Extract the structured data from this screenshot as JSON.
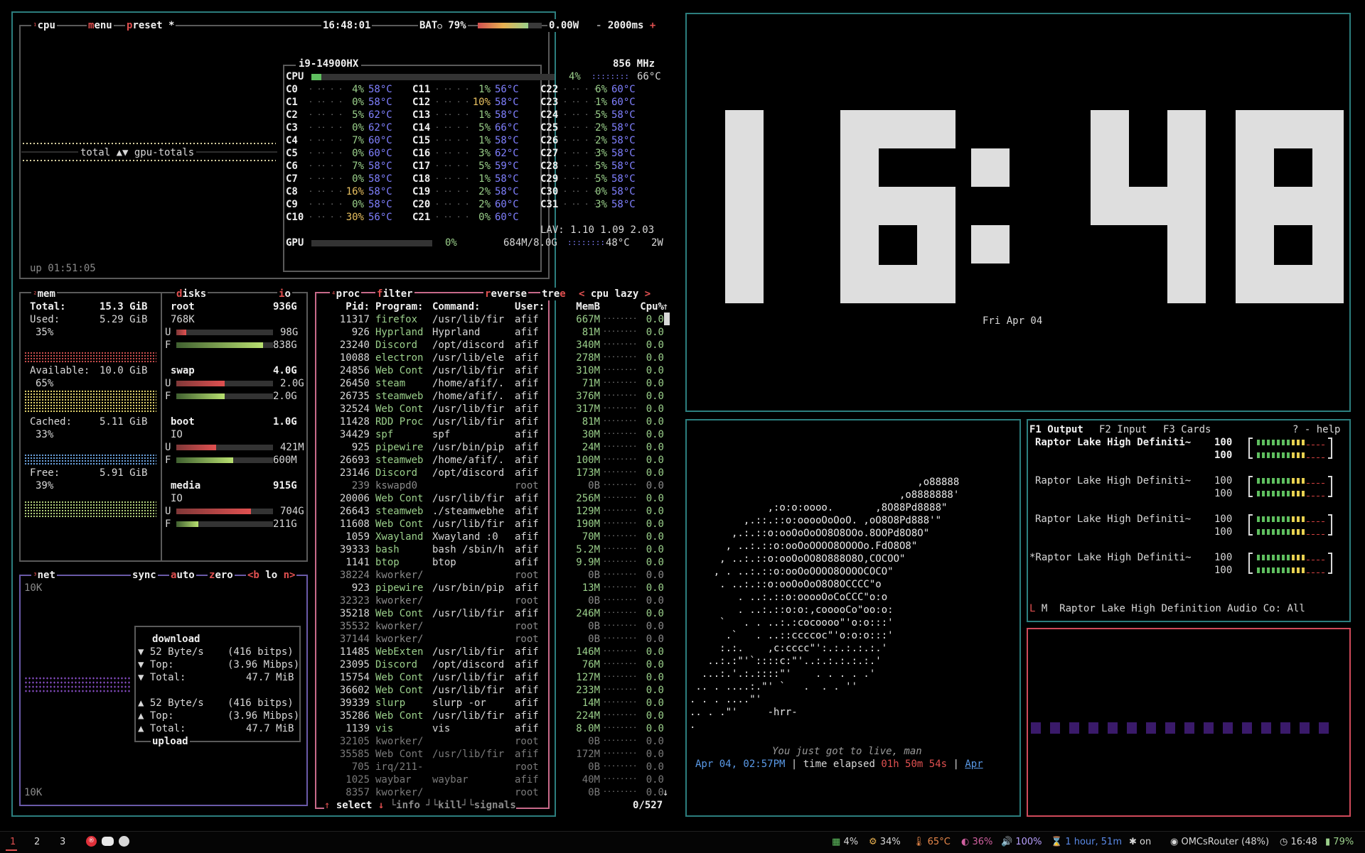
{
  "cpu": {
    "tab": "cpu",
    "menu": "menu",
    "preset": "preset *",
    "clock": "16:48:01",
    "bat_label": "BAT",
    "bat_pct": "79%",
    "bat_level": 0.79,
    "power": "0.00W",
    "interval": "2000ms",
    "model": "i9-14900HX",
    "freq": "856 MHz",
    "total_label": "CPU",
    "total_pct": "4%",
    "total_temp": "66°C",
    "total_level": 0.04,
    "graph_label": "total ▲▼ gpu-totals",
    "uptime": "up 01:51:05",
    "lav_label": "LAV:",
    "lav": "1.10 1.09 2.03",
    "gpu_label": "GPU",
    "gpu_pct": "0%",
    "gpu_mem": "684M/8.0G",
    "gpu_temp": "48°C",
    "gpu_power": "2W",
    "cores": [
      {
        "n": "C0",
        "p": "4%",
        "t": "58°C"
      },
      {
        "n": "C1",
        "p": "0%",
        "t": "58°C"
      },
      {
        "n": "C2",
        "p": "5%",
        "t": "62°C"
      },
      {
        "n": "C3",
        "p": "0%",
        "t": "62°C"
      },
      {
        "n": "C4",
        "p": "7%",
        "t": "60°C"
      },
      {
        "n": "C5",
        "p": "0%",
        "t": "60°C"
      },
      {
        "n": "C6",
        "p": "7%",
        "t": "58°C"
      },
      {
        "n": "C7",
        "p": "0%",
        "t": "58°C"
      },
      {
        "n": "C8",
        "p": "16%",
        "t": "58°C"
      },
      {
        "n": "C9",
        "p": "0%",
        "t": "58°C"
      },
      {
        "n": "C10",
        "p": "30%",
        "t": "56°C"
      },
      {
        "n": "C11",
        "p": "1%",
        "t": "56°C"
      },
      {
        "n": "C12",
        "p": "10%",
        "t": "58°C"
      },
      {
        "n": "C13",
        "p": "1%",
        "t": "58°C"
      },
      {
        "n": "C14",
        "p": "5%",
        "t": "66°C"
      },
      {
        "n": "C15",
        "p": "1%",
        "t": "58°C"
      },
      {
        "n": "C16",
        "p": "3%",
        "t": "62°C"
      },
      {
        "n": "C17",
        "p": "5%",
        "t": "59°C"
      },
      {
        "n": "C18",
        "p": "1%",
        "t": "58°C"
      },
      {
        "n": "C19",
        "p": "2%",
        "t": "58°C"
      },
      {
        "n": "C20",
        "p": "2%",
        "t": "60°C"
      },
      {
        "n": "C21",
        "p": "0%",
        "t": "60°C"
      },
      {
        "n": "C22",
        "p": "6%",
        "t": "60°C"
      },
      {
        "n": "C23",
        "p": "1%",
        "t": "60°C"
      },
      {
        "n": "C24",
        "p": "5%",
        "t": "58°C"
      },
      {
        "n": "C25",
        "p": "2%",
        "t": "58°C"
      },
      {
        "n": "C26",
        "p": "2%",
        "t": "58°C"
      },
      {
        "n": "C27",
        "p": "3%",
        "t": "58°C"
      },
      {
        "n": "C28",
        "p": "5%",
        "t": "58°C"
      },
      {
        "n": "C29",
        "p": "5%",
        "t": "58°C"
      },
      {
        "n": "C30",
        "p": "0%",
        "t": "58°C"
      },
      {
        "n": "C31",
        "p": "3%",
        "t": "58°C"
      }
    ]
  },
  "mem": {
    "tab": "mem",
    "disks_tab": "disks",
    "io_tab": "io",
    "total_label": "Total:",
    "total": "15.3 GiB",
    "used_label": "Used:",
    "used": "5.29 GiB",
    "used_pct": "35%",
    "avail_label": "Available:",
    "avail": "10.0 GiB",
    "avail_pct": "65%",
    "cached_label": "Cached:",
    "cached": "5.11 GiB",
    "cached_pct": "33%",
    "free_label": "Free:",
    "free": "5.91 GiB",
    "free_pct": "39%"
  },
  "disks": [
    {
      "name": "root",
      "size": "936G",
      "io": "768K",
      "used": "98G",
      "free": "838G",
      "u_level": 0.1,
      "f_level": 0.9
    },
    {
      "name": "swap",
      "size": "4.0G",
      "io": "",
      "used": "2.0G",
      "free": "2.0G",
      "u_level": 0.5,
      "f_level": 0.5
    },
    {
      "name": "boot",
      "size": "1.0G",
      "io": "IO",
      "used": "421M",
      "free": "600M",
      "u_level": 0.41,
      "f_level": 0.59
    },
    {
      "name": "media",
      "size": "915G",
      "io": "IO",
      "used": "704G",
      "free": "211G",
      "u_level": 0.77,
      "f_level": 0.23
    }
  ],
  "disk_u": "U",
  "disk_f": "F",
  "net": {
    "tab": "net",
    "sync": "sync",
    "auto": "auto",
    "zero": "zero",
    "iface": "<b lo n>",
    "scale_top": "10K",
    "scale_bottom": "10K",
    "download_title": "download",
    "upload_title": "upload",
    "dl_rate": "▼ 52 Byte/s",
    "dl_rate_bits": "(416 bitps)",
    "dl_top": "▼ Top:",
    "dl_top_val": "(3.96 Mibps)",
    "dl_total": "▼ Total:",
    "dl_total_val": "47.7 MiB",
    "ul_rate": "▲ 52 Byte/s",
    "ul_rate_bits": "(416 bitps)",
    "ul_top": "▲ Top:",
    "ul_top_val": "(3.96 Mibps)",
    "ul_total": "▲ Total:",
    "ul_total_val": "47.7 MiB"
  },
  "proc": {
    "tab": "proc",
    "filter": "filter",
    "reverse": "reverse",
    "tree": "tree",
    "sort": "cpu lazy",
    "sort_left": "<",
    "sort_right": ">",
    "headers": {
      "pid": "Pid:",
      "prog": "Program:",
      "cmd": "Command:",
      "user": "User:",
      "mem": "MemB",
      "cpu": "Cpu%"
    },
    "footer_select": "select",
    "footer_info": "info",
    "footer_kill": "kill",
    "footer_signals": "signals",
    "count": "0/527",
    "rows": [
      [
        "11317",
        "firefox",
        "/usr/lib/fir",
        "afif",
        "667M",
        "0.0"
      ],
      [
        "926",
        "Hyprland",
        "Hyprland",
        "afif",
        "81M",
        "0.0"
      ],
      [
        "23240",
        "Discord",
        "/opt/discord",
        "afif",
        "340M",
        "0.0"
      ],
      [
        "10088",
        "electron",
        "/usr/lib/ele",
        "afif",
        "278M",
        "0.0"
      ],
      [
        "24856",
        "Web Cont",
        "/usr/lib/fir",
        "afif",
        "310M",
        "0.0"
      ],
      [
        "26450",
        "steam",
        "/home/afif/.",
        "afif",
        "71M",
        "0.0"
      ],
      [
        "26735",
        "steamweb",
        "/home/afif/.",
        "afif",
        "376M",
        "0.0"
      ],
      [
        "32524",
        "Web Cont",
        "/usr/lib/fir",
        "afif",
        "317M",
        "0.0"
      ],
      [
        "11428",
        "RDD Proc",
        "/usr/lib/fir",
        "afif",
        "81M",
        "0.0"
      ],
      [
        "34429",
        "spf",
        "spf",
        "afif",
        "30M",
        "0.0"
      ],
      [
        "925",
        "pipewire",
        "/usr/bin/pip",
        "afif",
        "24M",
        "0.0"
      ],
      [
        "26693",
        "steamweb",
        "/home/afif/.",
        "afif",
        "100M",
        "0.0"
      ],
      [
        "23146",
        "Discord",
        "/opt/discord",
        "afif",
        "173M",
        "0.0"
      ],
      [
        "239",
        "kswapd0",
        "",
        "root",
        "0B",
        "0.0"
      ],
      [
        "20006",
        "Web Cont",
        "/usr/lib/fir",
        "afif",
        "256M",
        "0.0"
      ],
      [
        "26643",
        "steamweb",
        "./steamwebhe",
        "afif",
        "129M",
        "0.0"
      ],
      [
        "11608",
        "Web Cont",
        "/usr/lib/fir",
        "afif",
        "190M",
        "0.0"
      ],
      [
        "1059",
        "Xwayland",
        "Xwayland :0",
        "afif",
        "70M",
        "0.0"
      ],
      [
        "39333",
        "bash",
        "bash /sbin/h",
        "afif",
        "5.2M",
        "0.0"
      ],
      [
        "1141",
        "btop",
        "btop",
        "afif",
        "9.9M",
        "0.0"
      ],
      [
        "38224",
        "kworker/",
        "",
        "root",
        "0B",
        "0.0"
      ],
      [
        "923",
        "pipewire",
        "/usr/bin/pip",
        "afif",
        "13M",
        "0.0"
      ],
      [
        "32323",
        "kworker/",
        "",
        "root",
        "0B",
        "0.0"
      ],
      [
        "35218",
        "Web Cont",
        "/usr/lib/fir",
        "afif",
        "246M",
        "0.0"
      ],
      [
        "35532",
        "kworker/",
        "",
        "root",
        "0B",
        "0.0"
      ],
      [
        "37144",
        "kworker/",
        "",
        "root",
        "0B",
        "0.0"
      ],
      [
        "11485",
        "WebExten",
        "/usr/lib/fir",
        "afif",
        "146M",
        "0.0"
      ],
      [
        "23095",
        "Discord",
        "/opt/discord",
        "afif",
        "76M",
        "0.0"
      ],
      [
        "15754",
        "Web Cont",
        "/usr/lib/fir",
        "afif",
        "127M",
        "0.0"
      ],
      [
        "36602",
        "Web Cont",
        "/usr/lib/fir",
        "afif",
        "233M",
        "0.0"
      ],
      [
        "39339",
        "slurp",
        "slurp -or",
        "afif",
        "14M",
        "0.0"
      ],
      [
        "35286",
        "Web Cont",
        "/usr/lib/fir",
        "afif",
        "224M",
        "0.0"
      ],
      [
        "1139",
        "vis",
        "vis",
        "afif",
        "8.0M",
        "0.0"
      ],
      [
        "32105",
        "kworker/",
        "",
        "root",
        "0B",
        "0.0"
      ],
      [
        "35585",
        "Web Cont",
        "/usr/lib/fir",
        "afif",
        "172M",
        "0.0"
      ],
      [
        "705",
        "irq/211-",
        "",
        "root",
        "0B",
        "0.0"
      ],
      [
        "1025",
        "waybar",
        "waybar",
        "afif",
        "40M",
        "0.0"
      ],
      [
        "8357",
        "kworker/",
        "",
        "root",
        "0B",
        "0.0"
      ]
    ]
  },
  "clock": {
    "time_digits": "16:48",
    "date": "Fri Apr 04"
  },
  "art": {
    "lines": [
      "                                      ,o88888",
      "                                   ,o8888888'",
      "             ,:o:o:oooo.       ,8O88Pd8888\"",
      "         ,.::.::o:ooooOoOoO. ,oO8O8Pd888'\"",
      "       ,.:.::o:ooOoOoOO8O8OOo.8OOPd8O8O\"",
      "      , ..:.::o:ooOoOOOO8OOOOo.FdO8O8\"",
      "     , ..:.::o:ooOoOO8O888O8O,COCOO\"",
      "    , . ..:.::o:ooOoOOOO8OOOOCOCO\"",
      "     . ..:.::o:ooOoOoO8O8OCCCC\"o",
      "        . ..:.::o:ooooOoCoCCC\"o:o",
      "        . ..:.::o:o:,cooooCo\"oo:o:",
      "     `   . . ..:.:cocoooo\"'o:o:::'",
      "      .`   . ..::ccccoc\"'o:o:o:::'",
      "     :.:.    ,c:cccc\"':.:.:.:.:.'",
      "   ..:.:\"'`::::c:\"'..:.:.:.:.:.'",
      "  ...:.'.:.::::\"'    . . . . .'",
      " .. . ....:.\"' `   .  . . ''",
      ". . . ....\"'",
      ".. . .\"'     -hrr-",
      "."
    ],
    "quote": "You just got to live, man",
    "date_line": "Apr 04, 02:57PM",
    "sep": "|",
    "elapsed_label": "time elapsed",
    "elapsed": "01h 50m 54s",
    "trail": "Apr"
  },
  "audio": {
    "tab1": "F1 Output",
    "tab2": "F2 Input",
    "tab3": "F3 Cards",
    "help": "? - help",
    "devices": [
      {
        "name": "Raptor Lake High Definiti~",
        "l": "100",
        "r": "100",
        "level": 1.0
      },
      {
        "name": "Raptor Lake High Definiti~",
        "l": "100",
        "r": "100",
        "level": 1.0
      },
      {
        "name": "Raptor Lake High Definiti~",
        "l": "100",
        "r": "100",
        "level": 1.0
      },
      {
        "name": "*Raptor Lake High Definiti~",
        "l": "100",
        "r": "100",
        "level": 1.0
      }
    ],
    "footer_mark": "L",
    "footer_m": "M",
    "footer_name": "Raptor Lake High Definition Audio Co: All"
  },
  "taskbar": {
    "ws": [
      "1",
      "2",
      "3"
    ],
    "cpu": "4%",
    "mem": "34%",
    "temp": "65°C",
    "disk": "36%",
    "vol": "100%",
    "bat_time": "1 hour, 51m",
    "bt": "on",
    "wifi": "OMCsRouter (48%)",
    "time": "16:48",
    "bat": "79%"
  },
  "colors": {
    "accent": "#2c7e7e",
    "red": "#e05050",
    "green": "#5fbf5f",
    "blue": "#8080ff",
    "purple": "#7a3aa8"
  }
}
